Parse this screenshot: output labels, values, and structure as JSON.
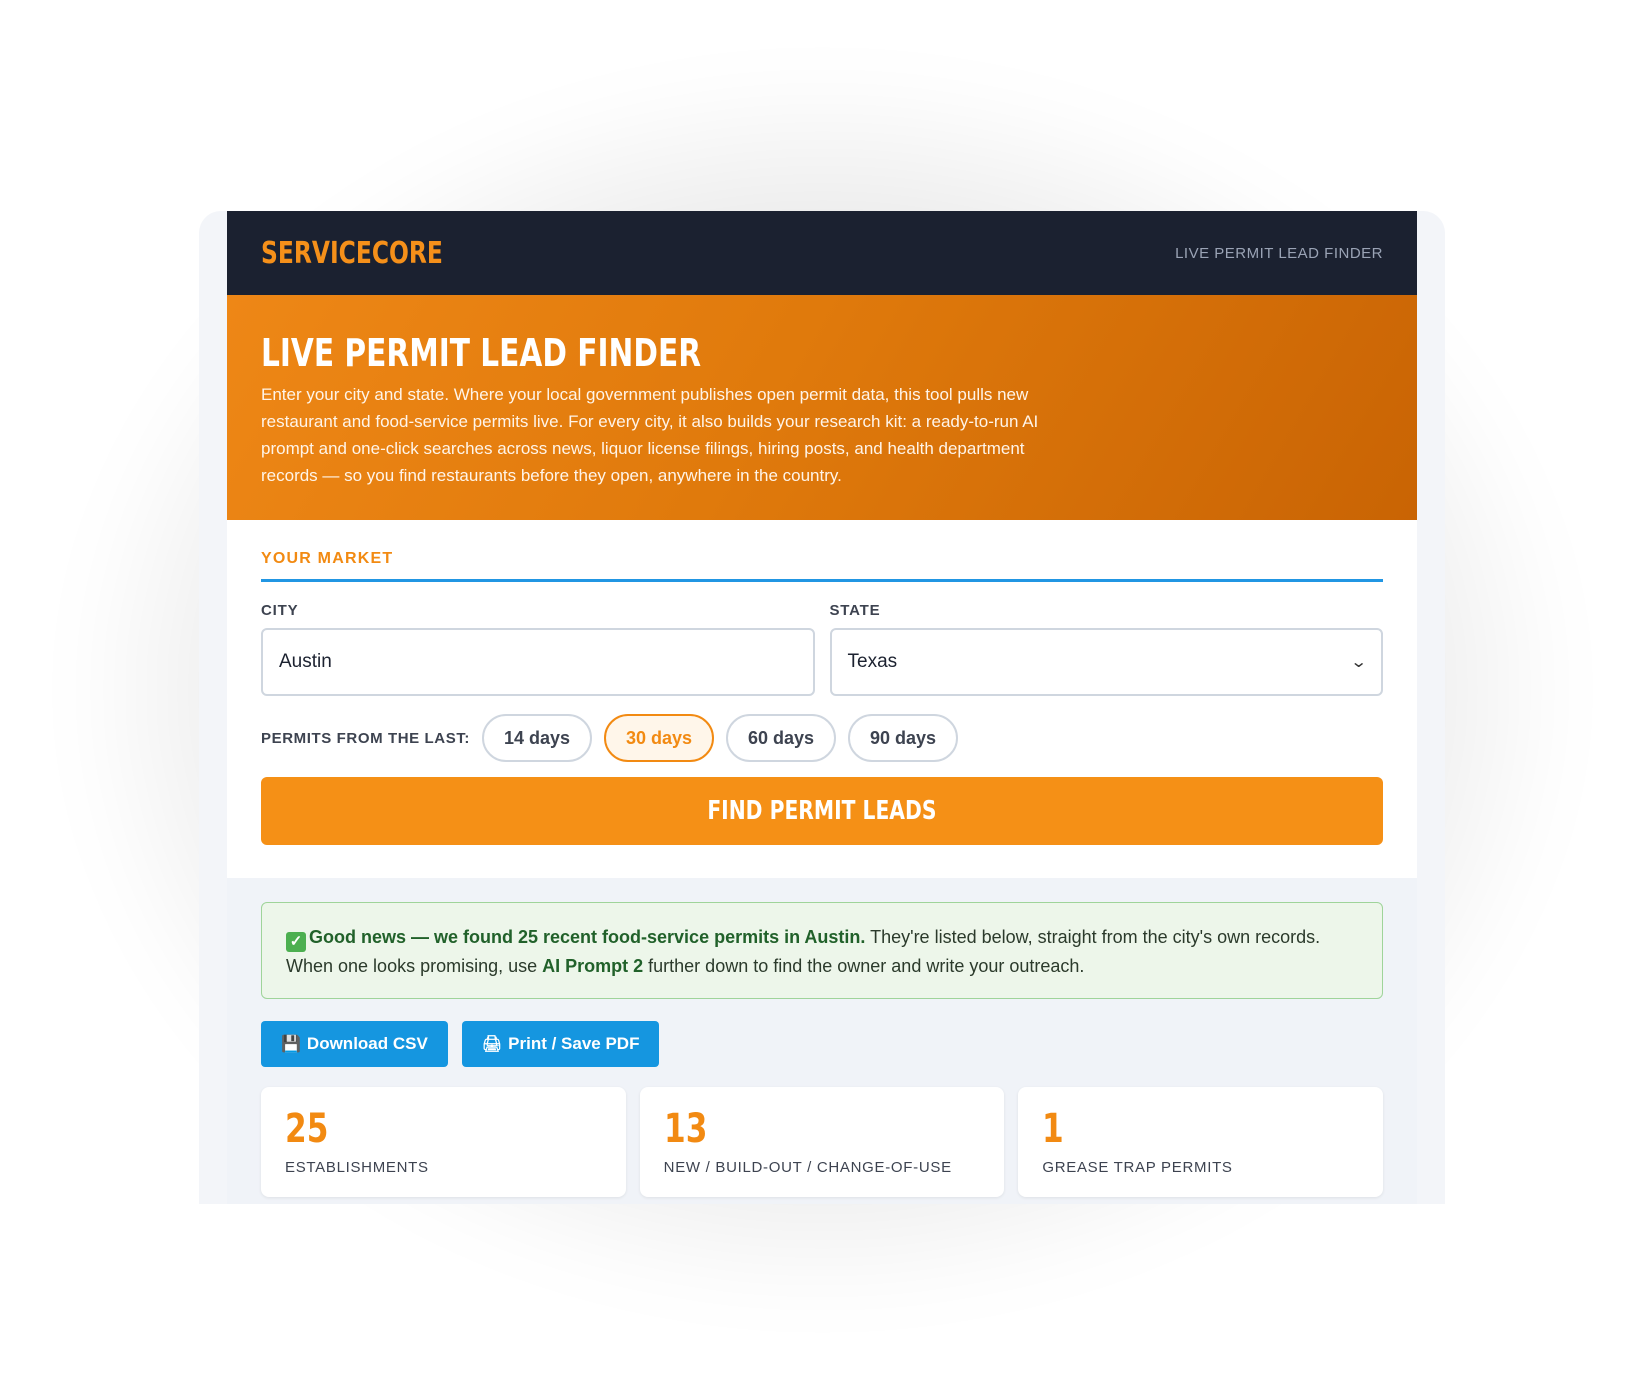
{
  "header": {
    "logo": "SERVICECORE",
    "right_label": "LIVE PERMIT LEAD FINDER"
  },
  "hero": {
    "title": "LIVE PERMIT LEAD FINDER",
    "description": "Enter your city and state. Where your local government publishes open permit data, this tool pulls new restaurant and food-service permits live. For every city, it also builds your research kit: a ready-to-run AI prompt and one-click searches across news, liquor license filings, hiring posts, and health department records — so you find restaurants before they open, anywhere in the country."
  },
  "market": {
    "section_title": "YOUR MARKET",
    "city_label": "CITY",
    "city_value": "Austin",
    "state_label": "STATE",
    "state_value": "Texas",
    "range_label": "PERMITS FROM THE LAST:",
    "ranges": [
      "14 days",
      "30 days",
      "60 days",
      "90 days"
    ],
    "selected_range": "30 days",
    "find_button": "FIND PERMIT LEADS"
  },
  "results": {
    "notice_bold": "Good news — we found 25 recent food-service permits in Austin.",
    "notice_text_1": " They're listed below, straight from the city's own records. When one looks promising, use ",
    "notice_link": "AI Prompt 2",
    "notice_text_2": " further down to find the owner and write your outreach.",
    "download_csv": "Download CSV",
    "print_pdf": "Print / Save PDF",
    "stats": [
      {
        "value": "25",
        "label": "ESTABLISHMENTS"
      },
      {
        "value": "13",
        "label": "NEW / BUILD-OUT / CHANGE-OF-USE"
      },
      {
        "value": "1",
        "label": "GREASE TRAP PERMITS"
      }
    ]
  },
  "colors": {
    "accent_orange": "#f59016",
    "header_dark": "#1b2130",
    "action_blue": "#1596e0",
    "success_green": "#edf6ea"
  },
  "icons": {
    "check": "check-box-icon",
    "save": "floppy-disk-icon",
    "print": "printer-icon",
    "dropdown": "chevron-down-icon"
  }
}
